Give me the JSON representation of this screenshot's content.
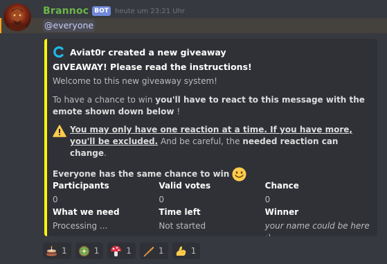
{
  "message": {
    "username": "Brannoc",
    "bot_tag": "BOT",
    "timestamp": "heute um 23:21 Uhr",
    "mention": "@everyone"
  },
  "embed": {
    "stripe_color": "#fdf40c",
    "author": "Aviat0r created a new giveaway",
    "title": "GIVEAWAY! Please read the instructions!",
    "line1": "Welcome to this new giveaway system!",
    "p2_a": "To have a chance to win ",
    "p2_b": "you'll have to react to this message with the emote shown down below",
    "p2_c": " !",
    "p3_a": "You may only have one reaction at a time. If you have more, you'll be excluded.",
    "p3_b": " And be careful, the ",
    "p3_c": "needed reaction can change",
    "p3_d": ".",
    "p4": "Everyone has the same chance to win",
    "fields": [
      {
        "name": "Participants",
        "value": "0"
      },
      {
        "name": "Valid votes",
        "value": "0"
      },
      {
        "name": "Chance",
        "value": "0"
      },
      {
        "name": "What we need",
        "value": "Processing ..."
      },
      {
        "name": "Time left",
        "value": "Not started"
      },
      {
        "name": "Winner",
        "value": "your name could be here :)"
      }
    ]
  },
  "reactions": [
    {
      "emoji": "cake-icon",
      "count": "1"
    },
    {
      "emoji": "kiwi-icon",
      "count": "1"
    },
    {
      "emoji": "mushroom-icon",
      "count": "1"
    },
    {
      "emoji": "baguette-icon",
      "count": "1"
    },
    {
      "emoji": "flexed-bicep-icon",
      "count": "1"
    }
  ],
  "colors": {
    "username": "#6bb54a",
    "bot_tag": "#7289da",
    "mention_highlight": "#faa61a",
    "embed_stripe": "#fdf40c"
  }
}
